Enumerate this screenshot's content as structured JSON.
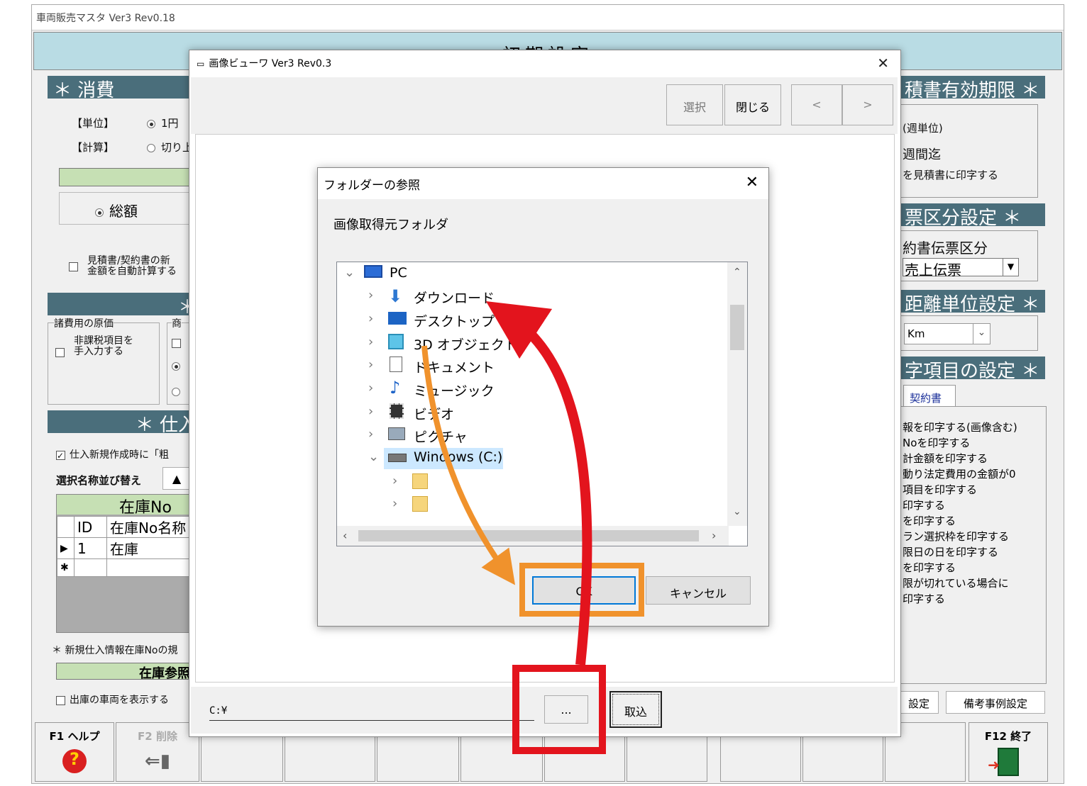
{
  "app": {
    "title": "車両販売マスタ Ver3 Rev0.18",
    "header": "初期設定",
    "left": {
      "tax_title": "＊ 消費",
      "unit_label": "【単位】",
      "unit_value": "1円",
      "calc_label": "【計算】",
      "calc_value": "切り上",
      "total_label": "総額",
      "auto_calc_line1": "見積書/契約書の新",
      "auto_calc_line2": "金額を自動計算する",
      "mid_title": "＊",
      "cost_group_label": "諸費用の原価",
      "nontax_line1": "非課税項目を",
      "nontax_line2": "手入力する",
      "product_group_label": "商",
      "purchase_title": "＊ 仕入",
      "purchase_check": "仕入新規作成時に「粗",
      "sort_label": "選択名称並び替え",
      "sort_button": "▲",
      "grid_header": "在庫No",
      "grid_col_id": "ID",
      "grid_col_name": "在庫No名称",
      "grid_row_marker": "▶",
      "grid_row_id": "1",
      "grid_row_name": "在庫",
      "grid_new_marker": "✱",
      "note": "＊ 新規仕入情報在庫Noの規",
      "stock_ref": "在庫参照",
      "show_shipped": "出庫の車両を表示する"
    },
    "right": {
      "estimate_title": "積書有効期限 ＊",
      "week_unit": "(週単位)",
      "weeks_until": "週間迄",
      "print_on_estimate": "を見積書に印字する",
      "slip_title": "票区分設定 ＊",
      "contract_slip": "約書伝票区分",
      "slip_value": "売上伝票",
      "distance_title": "距離単位設定 ＊",
      "distance_value": "Km",
      "print_title": "字項目の設定 ＊",
      "contract_tab": "契約書",
      "print_items": [
        "報を印字する(画像含む)",
        "Noを印字する",
        "計金額を印字する",
        "動り法定費用の金額が0",
        "項目を印字する",
        "印字する",
        "を印字する",
        "ラン選択枠を印字する",
        "限日の日を印字する",
        "を印字する",
        "限が切れている場合に",
        "印字する"
      ],
      "btn_settings": "設定",
      "btn_remarks": "備考事例設定"
    },
    "fkeys": {
      "f1": "F1 ヘルプ",
      "f2": "F2 削除",
      "f12": "F12 終了"
    }
  },
  "viewer": {
    "title": "画像ビューワ Ver3 Rev0.3",
    "close": "✕",
    "btn_select": "選択",
    "btn_close": "閉じる",
    "btn_prev": "<",
    "btn_next": ">",
    "path": "C:¥",
    "btn_browse": "...",
    "btn_import": "取込"
  },
  "dialog": {
    "title": "フォルダーの参照",
    "close": "✕",
    "label": "画像取得元フォルダ",
    "tree": [
      {
        "label": "PC",
        "icon": "pc-icon"
      },
      {
        "label": "ダウンロード",
        "icon": "download-arrow-icon"
      },
      {
        "label": "デスクトップ",
        "icon": "desktop-icon"
      },
      {
        "label": "3D オブジェクト",
        "icon": "cube-icon"
      },
      {
        "label": "ドキュメント",
        "icon": "document-icon"
      },
      {
        "label": "ミュージック",
        "icon": "music-note-icon"
      },
      {
        "label": "ビデオ",
        "icon": "film-icon"
      },
      {
        "label": "ピクチャ",
        "icon": "picture-icon"
      },
      {
        "label": "Windows (C:)",
        "icon": "drive-icon"
      }
    ],
    "btn_ok": "OK",
    "btn_cancel": "キャンセル"
  },
  "colors": {
    "section": "#4a6e7b",
    "header": "#b9dce4",
    "highlight_red": "#e3141d",
    "highlight_orange": "#f0922c",
    "focus_blue": "#0078d7"
  }
}
